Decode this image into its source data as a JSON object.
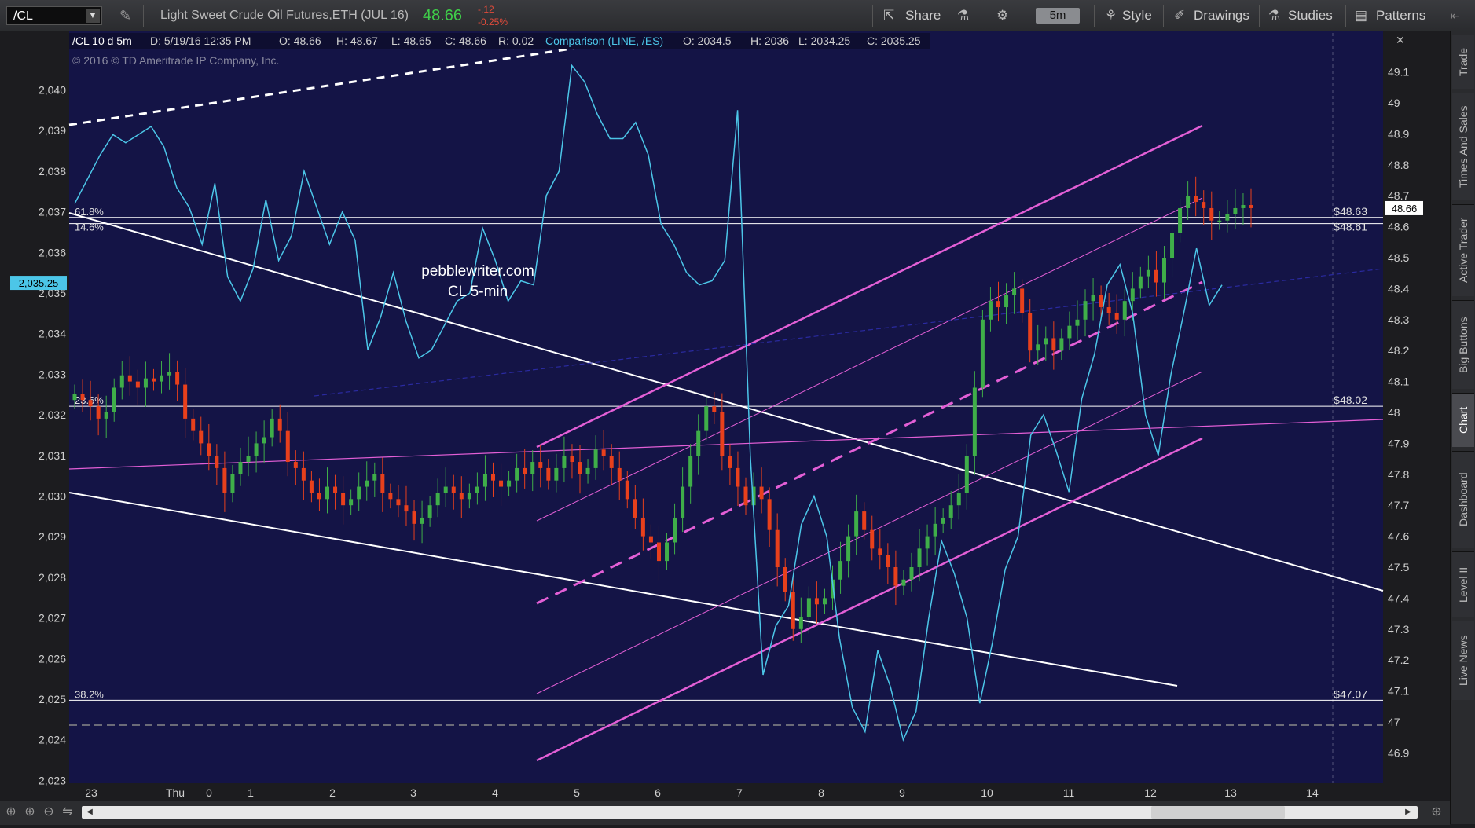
{
  "header": {
    "symbol": "/CL",
    "description": "Light Sweet Crude Oil Futures,ETH (JUL 16)",
    "last": "48.66",
    "change": "-.12",
    "change_pct": "-0.25%",
    "share_label": "Share",
    "timeframe": "5m",
    "style_label": "Style",
    "drawings_label": "Drawings",
    "studies_label": "Studies",
    "patterns_label": "Patterns"
  },
  "infobar": {
    "title": "/CL 10 d 5m",
    "date": "D: 5/19/16 12:35 PM",
    "open": "O: 48.66",
    "high": "H: 48.67",
    "low": "L: 48.65",
    "close": "C: 48.66",
    "range": "R: 0.02",
    "comparison": "Comparison (LINE, /ES)",
    "cmp_open": "O: 2034.5",
    "cmp_high": "H: 2036",
    "cmp_low": "L: 2034.25",
    "cmp_close": "C: 2035.25",
    "copyright": "© 2016 © TD Ameritrade IP Company, Inc."
  },
  "watermark": {
    "line1": "pebblewriter.com",
    "line2": "CL 5-min"
  },
  "left_axis": {
    "labels": [
      "2,040",
      "2,039",
      "2,038",
      "2,037",
      "2,036",
      "2,035",
      "2,034",
      "2,033",
      "2,032",
      "2,031",
      "2,030",
      "2,029",
      "2,028",
      "2,027",
      "2,026",
      "2,025",
      "2,024",
      "2,023"
    ],
    "highlight": "2,035.25"
  },
  "right_axis": {
    "labels": [
      "49.1",
      "49",
      "48.9",
      "48.8",
      "48.7",
      "48.6",
      "48.5",
      "48.4",
      "48.3",
      "48.2",
      "48.1",
      "48",
      "47.9",
      "47.8",
      "47.7",
      "47.6",
      "47.5",
      "47.4",
      "47.3",
      "47.2",
      "47.1",
      "47",
      "46.9"
    ],
    "highlight": "48.66"
  },
  "time_axis": [
    "23",
    "Thu",
    "0",
    "1",
    "2",
    "3",
    "4",
    "5",
    "6",
    "7",
    "8",
    "9",
    "10",
    "11",
    "12",
    "13",
    "14"
  ],
  "fib_levels": [
    {
      "pct": "61.8%",
      "price": "$48.63"
    },
    {
      "pct": "14.6%",
      "price": "$48.61"
    },
    {
      "pct": "23.6%",
      "price": "$48.02"
    },
    {
      "pct": "38.2%",
      "price": "$47.07"
    }
  ],
  "sidebar": [
    "Trade",
    "Times And Sales",
    "Active Trader",
    "Big Buttons",
    "Chart",
    "Dashboard",
    "Level II",
    "Live News"
  ],
  "colors": {
    "plot_bg": "#141446",
    "up": "#3fae49",
    "down": "#e8401c",
    "comparison": "#4cc6e8",
    "channel": "#e35fd6",
    "trend": "#ffffff"
  },
  "chart_data": {
    "type": "candlestick",
    "primary": {
      "symbol": "/CL",
      "close_series_approx": [
        48.06,
        48.04,
        48.02,
        47.98,
        48.0,
        48.08,
        48.12,
        48.1,
        48.08,
        48.11,
        48.1,
        48.12,
        48.13,
        48.09,
        47.98,
        47.94,
        47.9,
        47.86,
        47.82,
        47.74,
        47.8,
        47.84,
        47.86,
        47.9,
        47.92,
        47.98,
        47.94,
        47.84,
        47.82,
        47.78,
        47.74,
        47.72,
        47.76,
        47.74,
        47.7,
        47.72,
        47.76,
        47.78,
        47.8,
        47.74,
        47.72,
        47.7,
        47.68,
        47.64,
        47.66,
        47.7,
        47.74,
        47.76,
        47.74,
        47.72,
        47.74,
        47.76,
        47.8,
        47.78,
        47.76,
        47.78,
        47.82,
        47.8,
        47.84,
        47.82,
        47.78,
        47.82,
        47.86,
        47.84,
        47.8,
        47.82,
        47.88,
        47.86,
        47.82,
        47.78,
        47.72,
        47.66,
        47.6,
        47.58,
        47.52,
        47.58,
        47.66,
        47.76,
        47.86,
        47.94,
        48.02,
        48.0,
        47.86,
        47.82,
        47.76,
        47.7,
        47.76,
        47.72,
        47.62,
        47.5,
        47.42,
        47.3,
        47.34,
        47.4,
        47.38,
        47.4,
        47.46,
        47.52,
        47.6,
        47.68,
        47.62,
        47.56,
        47.54,
        47.5,
        47.44,
        47.46,
        47.5,
        47.56,
        47.6,
        47.64,
        47.66,
        47.7,
        47.74,
        47.86,
        48.08,
        48.3,
        48.36,
        48.34,
        48.38,
        48.4,
        48.32,
        48.2,
        48.22,
        48.24,
        48.2,
        48.24,
        48.28,
        48.3,
        48.36,
        48.38,
        48.34,
        48.32,
        48.3,
        48.36,
        48.4,
        48.44,
        48.46,
        48.42,
        48.5,
        48.58,
        48.66,
        48.7,
        48.68,
        48.66,
        48.62,
        48.62,
        48.64,
        48.66,
        48.67,
        48.66
      ]
    },
    "comparison": {
      "symbol": "/ES",
      "type": "line",
      "close_series_approx": [
        2037.2,
        2037.8,
        2038.4,
        2038.9,
        2038.7,
        2038.9,
        2039.1,
        2038.6,
        2037.6,
        2037.1,
        2036.2,
        2037.7,
        2035.4,
        2034.8,
        2035.6,
        2037.3,
        2035.8,
        2036.4,
        2038.0,
        2037.1,
        2036.2,
        2037.0,
        2036.3,
        2033.6,
        2034.4,
        2035.5,
        2034.3,
        2033.4,
        2033.6,
        2034.2,
        2034.8,
        2035.0,
        2036.6,
        2035.8,
        2034.8,
        2035.3,
        2035.2,
        2037.4,
        2038.0,
        2040.6,
        2040.2,
        2039.4,
        2038.8,
        2038.8,
        2039.2,
        2038.4,
        2036.7,
        2036.2,
        2035.5,
        2035.2,
        2035.3,
        2035.8,
        2039.5,
        2031.0,
        2025.6,
        2026.8,
        2027.3,
        2029.3,
        2030.0,
        2029.0,
        2026.5,
        2024.8,
        2024.2,
        2026.2,
        2025.3,
        2024.0,
        2024.7,
        2027.0,
        2028.9,
        2028.1,
        2027.0,
        2024.9,
        2026.4,
        2028.2,
        2029.0,
        2031.5,
        2032.0,
        2031.1,
        2030.1,
        2032.4,
        2033.5,
        2035.2,
        2035.7,
        2034.5,
        2032.0,
        2031.0,
        2033.0,
        2034.5,
        2036.1,
        2034.7,
        2035.2
      ],
      "last": 2035.25
    },
    "fib_retracements": [
      {
        "label": "61.8%",
        "price": 48.63
      },
      {
        "label": "14.6%",
        "price": 48.61
      },
      {
        "label": "23.6%",
        "price": 48.02
      },
      {
        "label": "38.2%",
        "price": 47.07
      }
    ],
    "left_ylim": [
      2023,
      2040.5
    ],
    "right_ylim": [
      46.85,
      49.15
    ],
    "x_ticks": [
      "23",
      "Thu",
      "0",
      "1",
      "2",
      "3",
      "4",
      "5",
      "6",
      "7",
      "8",
      "9",
      "10",
      "11",
      "12",
      "13",
      "14"
    ],
    "grid": false
  }
}
